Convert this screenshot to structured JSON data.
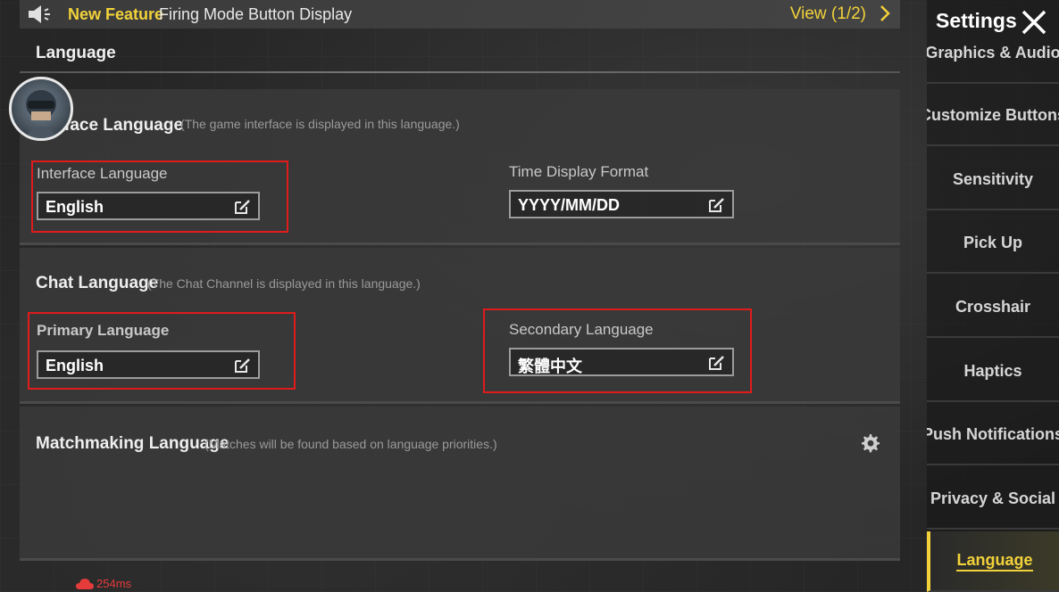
{
  "banner": {
    "new_feature": "New Feature",
    "feature_text": "Firing Mode Button Display",
    "view": "View (1/2)"
  },
  "page_title": "Language",
  "interface_section": {
    "title": "Interface Language",
    "title_visible": "face Language",
    "hint": "(The game interface is displayed in this language.)",
    "interface_label": "Interface Language",
    "interface_value": "English",
    "time_label": "Time Display Format",
    "time_value": "YYYY/MM/DD"
  },
  "chat_section": {
    "title": "Chat Language",
    "hint": "(The Chat Channel is displayed in this language.)",
    "primary_label": "Primary Language",
    "primary_value": "English",
    "secondary_label": "Secondary Language",
    "secondary_value": "繁體中文"
  },
  "matchmaking_section": {
    "title": "Matchmaking Language",
    "hint": "(Matches will be found based on language priorities.)"
  },
  "sidebar": {
    "title": "Settings",
    "items": [
      {
        "label": "Graphics & Audio"
      },
      {
        "label": "Customize Buttons"
      },
      {
        "label": "Sensitivity"
      },
      {
        "label": "Pick Up"
      },
      {
        "label": "Crosshair"
      },
      {
        "label": "Haptics"
      },
      {
        "label": "Push Notifications"
      },
      {
        "label": "Privacy & Social"
      },
      {
        "label": "Language",
        "active": true
      }
    ]
  },
  "ping": "254ms",
  "colors": {
    "accent": "#f2d23a",
    "highlight": "#e01b1b",
    "ping": "#e53b3b"
  },
  "icons": [
    "speaker-icon",
    "chevron-right-icon",
    "edit-icon",
    "gear-icon",
    "close-icon",
    "cloud-icon",
    "avatar"
  ]
}
